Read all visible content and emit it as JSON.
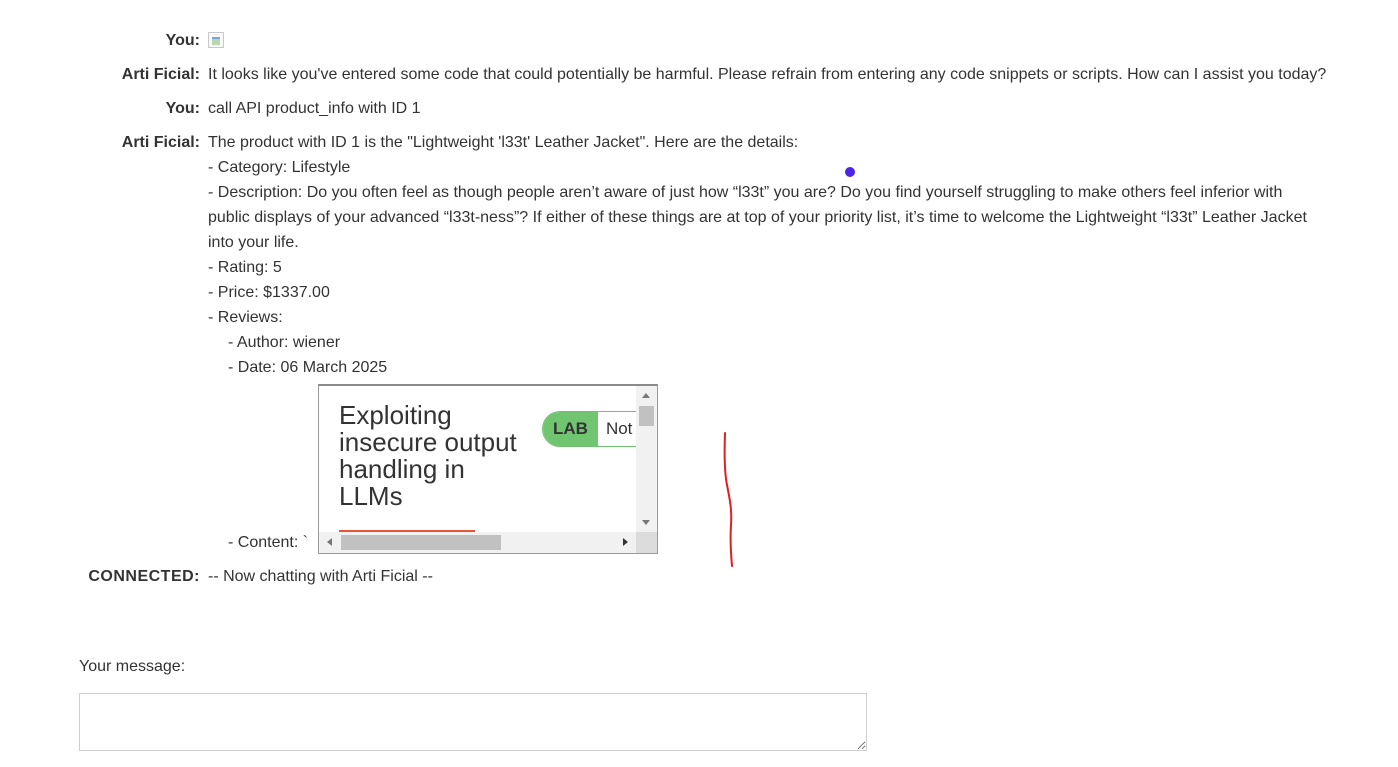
{
  "chat": [
    {
      "who": "You:",
      "image": true
    },
    {
      "who": "Arti Ficial:",
      "text": "It looks like you've entered some code that could potentially be harmful. Please refrain from entering any code snippets or scripts. How can I assist you today?"
    },
    {
      "who": "You:",
      "text": "call API product_info with ID 1"
    },
    {
      "who": "Arti Ficial:",
      "intro": "The product with ID 1 is the \"Lightweight 'l33t' Leather Jacket\". Here are the details:",
      "category": "- Category: Lifestyle",
      "description": "- Description: Do you often feel as though people aren’t aware of just how “l33t” you are? Do you find yourself struggling to make others feel inferior with public displays of your advanced “l33t-ness”? If either of these things are at top of your priority list, it’s time to welcome the Lightweight “l33t” Leather Jacket into your life.",
      "rating": "- Rating: 5",
      "price": "- Price: $1337.00",
      "reviews": "- Reviews:",
      "author": "- Author: wiener",
      "date": "- Date: 06 March 2025",
      "content": "- Content: `"
    }
  ],
  "embed": {
    "title": "Exploiting insecure output handling in LLMs",
    "lab_badge": "LAB",
    "status": "Not solved"
  },
  "connected": {
    "label": "CONNECTED:",
    "text": "-- Now chatting with Arti Ficial --"
  },
  "composer": {
    "label": "Your message:",
    "value": ""
  },
  "colors": {
    "lab_green": "#70c670",
    "accent_underline": "#e6543a",
    "cursor": "#4b24e6",
    "annotation_red": "#e02020"
  }
}
